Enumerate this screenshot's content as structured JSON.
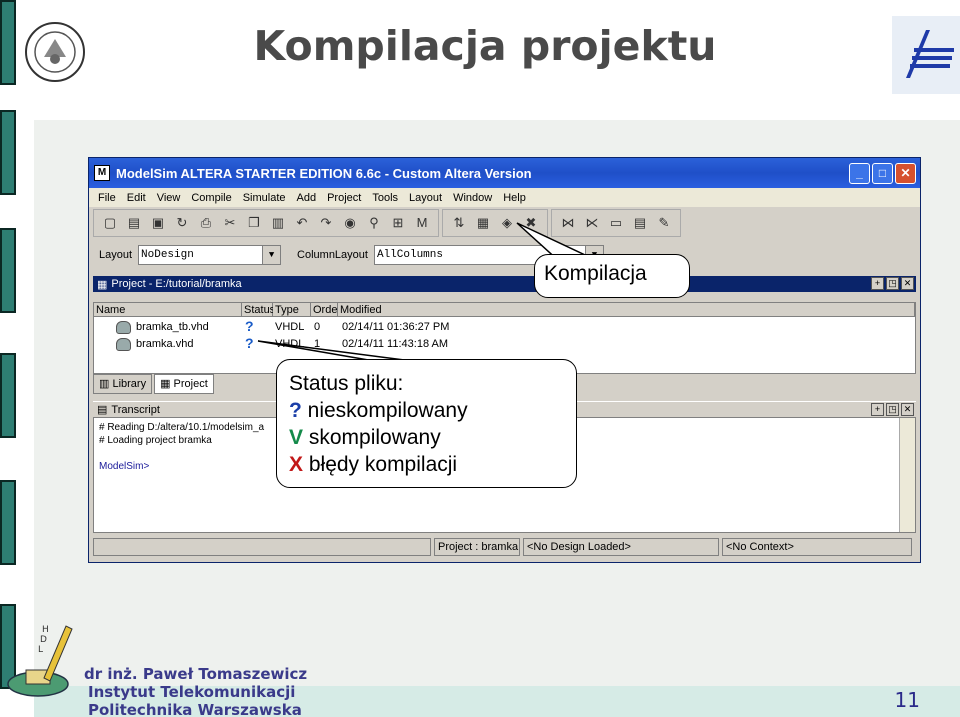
{
  "slide": {
    "title": "Kompilacja projektu",
    "author": "dr inż. Paweł Tomaszewicz",
    "institute_line1": "Instytut Telekomunikacji",
    "institute_line2": "Politechnika Warszawska",
    "page_number": "11"
  },
  "window": {
    "title": "ModelSim ALTERA STARTER EDITION 6.6c - Custom Altera Version",
    "menu": [
      "File",
      "Edit",
      "View",
      "Compile",
      "Simulate",
      "Add",
      "Project",
      "Tools",
      "Layout",
      "Window",
      "Help"
    ],
    "layout_label": "Layout",
    "layout_value": "NoDesign",
    "column_layout_label": "ColumnLayout",
    "column_layout_value": "AllColumns",
    "project_panel_title": "Project - E:/tutorial/bramka",
    "columns": [
      "Name",
      "Status",
      "Type",
      "Order",
      "Modified"
    ],
    "files": [
      {
        "name": "bramka_tb.vhd",
        "status": "?",
        "type": "VHDL",
        "order": "0",
        "modified": "02/14/11 01:36:27 PM"
      },
      {
        "name": "bramka.vhd",
        "status": "?",
        "type": "VHDL",
        "order": "1",
        "modified": "02/14/11 11:43:18 AM"
      }
    ],
    "tabs": [
      "Library",
      "Project"
    ],
    "transcript_title": "Transcript",
    "transcript_lines": [
      "# Reading D:/altera/10.1/modelsim_a",
      "# Loading project bramka",
      "",
      "ModelSim>"
    ],
    "status_project": "Project : bramka",
    "status_design": "<No Design Loaded>",
    "status_context": "<No Context>"
  },
  "callouts": {
    "compile": "Kompilacja",
    "status_title": "Status pliku:",
    "q_sym": "?",
    "q_text": " nieskompilowany",
    "v_sym": "V",
    "v_text": " skompilowany",
    "x_sym": "X",
    "x_text": " błędy kompilacji"
  },
  "colors": {
    "accent": "#2e7e73",
    "title_bar": "#2b61d9"
  }
}
